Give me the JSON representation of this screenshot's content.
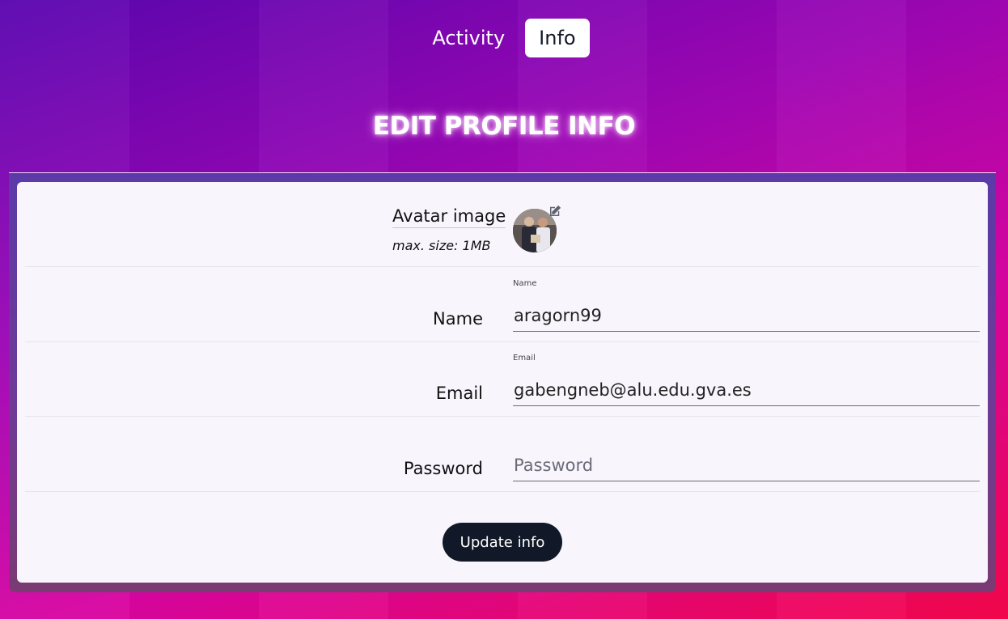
{
  "tabs": [
    {
      "label": "Activity",
      "active": false
    },
    {
      "label": "Info",
      "active": true
    }
  ],
  "page_title": "EDIT PROFILE INFO",
  "avatar": {
    "label": "Avatar image",
    "hint": "max. size: 1MB",
    "edit_icon": "edit-icon"
  },
  "fields": {
    "name": {
      "label": "Name",
      "caption": "Name",
      "value": "aragorn99"
    },
    "email": {
      "label": "Email",
      "caption": "Email",
      "value": "gabengneb@alu.edu.gva.es"
    },
    "password": {
      "label": "Password",
      "placeholder": "Password",
      "value": ""
    }
  },
  "submit_label": "Update info",
  "colors": {
    "accent_dark": "#111827",
    "card_bg": "#f8f6fc",
    "gradient_start": "#5a06b0",
    "gradient_end": "#f5064a"
  }
}
